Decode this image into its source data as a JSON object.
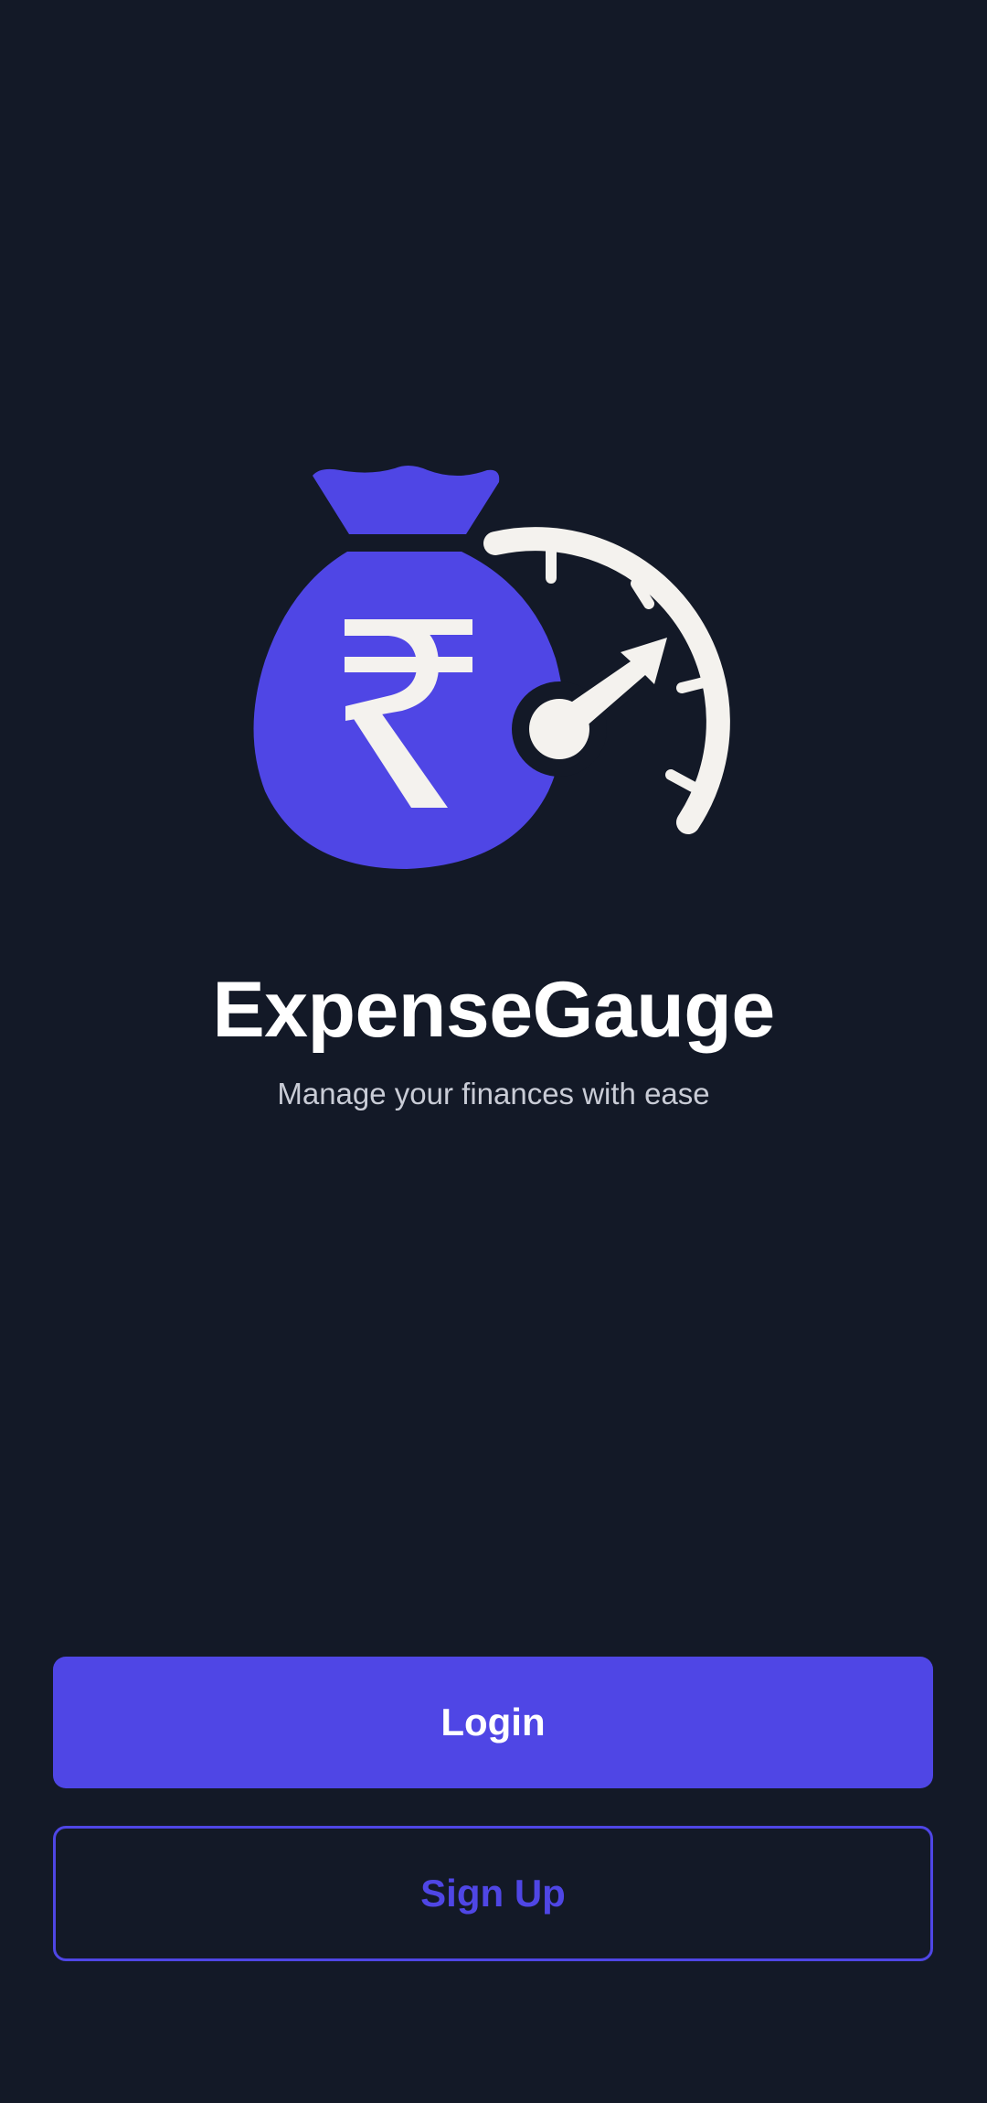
{
  "app": {
    "title": "ExpenseGauge",
    "tagline": "Manage your finances with ease"
  },
  "actions": {
    "login_label": "Login",
    "signup_label": "Sign Up"
  },
  "logo": {
    "icon": "money-bag-rupee-gauge-icon",
    "bag_color": "#4f46e5",
    "symbol_color": "#f4f2ee"
  },
  "colors": {
    "background": "#131927",
    "accent": "#4f46e5",
    "tagline": "#c9ccd6"
  }
}
